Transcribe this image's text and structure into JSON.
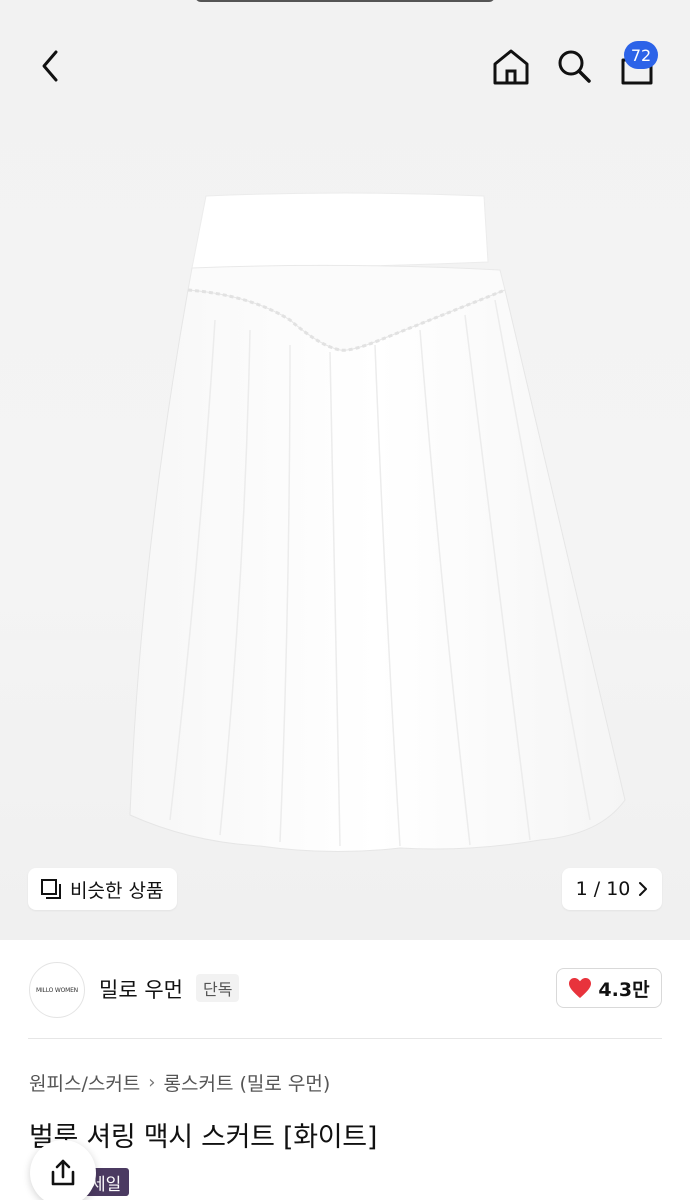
{
  "header": {
    "back_icon": "chevron-left-icon",
    "home_icon": "home-icon",
    "search_icon": "search-icon",
    "cart_icon": "shopping-bag-icon",
    "cart_count": "72",
    "badge_color": "#2c63e8"
  },
  "gallery": {
    "similar_label": "비슷한 상품",
    "page_indicator": "1 / 10"
  },
  "brand": {
    "logo_text": "MILLO WOMEN",
    "name": "밀로 우먼",
    "tag": "단독",
    "likes": "4.3만",
    "heart_color": "#e8333c"
  },
  "breadcrumb": {
    "level1": "원피스/스커트",
    "level2": "롱스커트 (밀로 우먼)"
  },
  "product": {
    "title": "벌룬 셔링 맥시 스커트 [화이트]",
    "sale_label": "세일",
    "sale_color": "#4b3a61"
  }
}
